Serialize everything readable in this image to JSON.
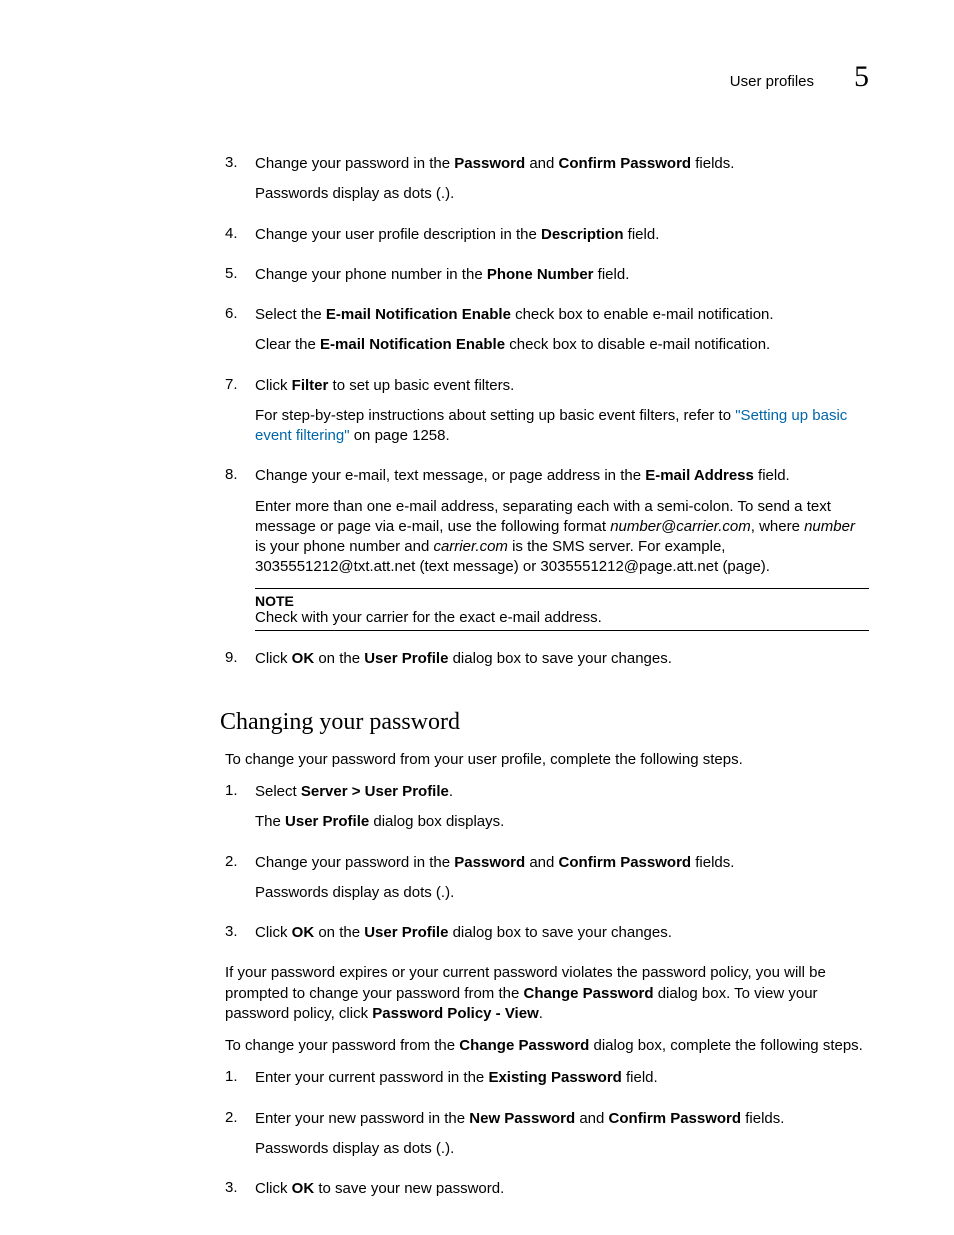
{
  "header": {
    "title": "User profiles",
    "chapter": "5"
  },
  "listA": {
    "items": [
      {
        "num": "3.",
        "p1_pre": "Change your password in the ",
        "p1_b1": "Password",
        "p1_mid": " and ",
        "p1_b2": "Confirm Password",
        "p1_suf": " fields.",
        "p2": "Passwords display as dots (.)."
      },
      {
        "num": "4.",
        "p1_pre": "Change your user profile description in the ",
        "p1_b1": "Description",
        "p1_suf": " field."
      },
      {
        "num": "5.",
        "p1_pre": "Change your phone number in the ",
        "p1_b1": "Phone Number",
        "p1_suf": " field."
      },
      {
        "num": "6.",
        "p1_pre": "Select the ",
        "p1_b1": "E-mail Notification Enable",
        "p1_suf": " check box to enable e-mail notification.",
        "p2_pre": "Clear the ",
        "p2_b1": "E-mail Notification Enable",
        "p2_suf": " check box to disable e-mail notification."
      },
      {
        "num": "7.",
        "p1_pre": "Click ",
        "p1_b1": "Filter",
        "p1_suf": " to set up basic event filters.",
        "p2_pre": "For step-by-step instructions about setting up basic event filters, refer to ",
        "p2_link": "\"Setting up basic event filtering\"",
        "p2_suf": " on page 1258."
      },
      {
        "num": "8.",
        "p1_pre": "Change your e-mail, text message, or page address in the ",
        "p1_b1": "E-mail Address",
        "p1_suf": " field.",
        "p2_pre": "Enter more than one e-mail address, separating each with a semi-colon. To send a text message or page via e-mail, use the following format ",
        "p2_i1": "number@carrier.com",
        "p2_mid1": ", where ",
        "p2_i2": "number",
        "p2_mid2": " is your phone number and ",
        "p2_i3": "carrier.com",
        "p2_suf": " is the SMS server. For example, 3035551212@txt.att.net (text message) or 3035551212@page.att.net (page).",
        "note_label": "NOTE",
        "note_text": "Check with your carrier for the exact e-mail address."
      },
      {
        "num": "9.",
        "p1_pre": "Click ",
        "p1_b1": "OK",
        "p1_mid": " on the ",
        "p1_b2": "User Profile",
        "p1_suf": " dialog box to save your changes."
      }
    ]
  },
  "section_heading": "Changing your password",
  "intro_para": "To change your password from your user profile, complete the following steps.",
  "listB": {
    "items": [
      {
        "num": "1.",
        "p1_pre": "Select ",
        "p1_b1": "Server > User Profile",
        "p1_suf": ".",
        "p2_pre": "The ",
        "p2_b1": "User Profile",
        "p2_suf": " dialog box displays."
      },
      {
        "num": "2.",
        "p1_pre": "Change your password in the ",
        "p1_b1": "Password",
        "p1_mid": " and ",
        "p1_b2": "Confirm Password",
        "p1_suf": " fields.",
        "p2": "Passwords display as dots (.)."
      },
      {
        "num": "3.",
        "p1_pre": "Click ",
        "p1_b1": "OK",
        "p1_mid": " on the ",
        "p1_b2": "User Profile",
        "p1_suf": " dialog box to save your changes."
      }
    ]
  },
  "policy_para": {
    "pre": "If your password expires or your current password violates the password policy, you will be prompted to change your password from the ",
    "b1": "Change Password",
    "mid": " dialog box. To view your password policy, click ",
    "b2": "Password Policy - View",
    "suf": "."
  },
  "change_intro": {
    "pre": "To change your password from the ",
    "b1": "Change Password",
    "suf": " dialog box, complete the following steps."
  },
  "listC": {
    "items": [
      {
        "num": "1.",
        "p1_pre": "Enter your current password in the ",
        "p1_b1": "Existing Password",
        "p1_suf": " field."
      },
      {
        "num": "2.",
        "p1_pre": "Enter your new password in the ",
        "p1_b1": "New Password",
        "p1_mid": " and ",
        "p1_b2": "Confirm Password",
        "p1_suf": " fields.",
        "p2": "Passwords display as dots (.)."
      },
      {
        "num": "3.",
        "p1_pre": "Click ",
        "p1_b1": "OK",
        "p1_suf": " to save your new password."
      }
    ]
  }
}
